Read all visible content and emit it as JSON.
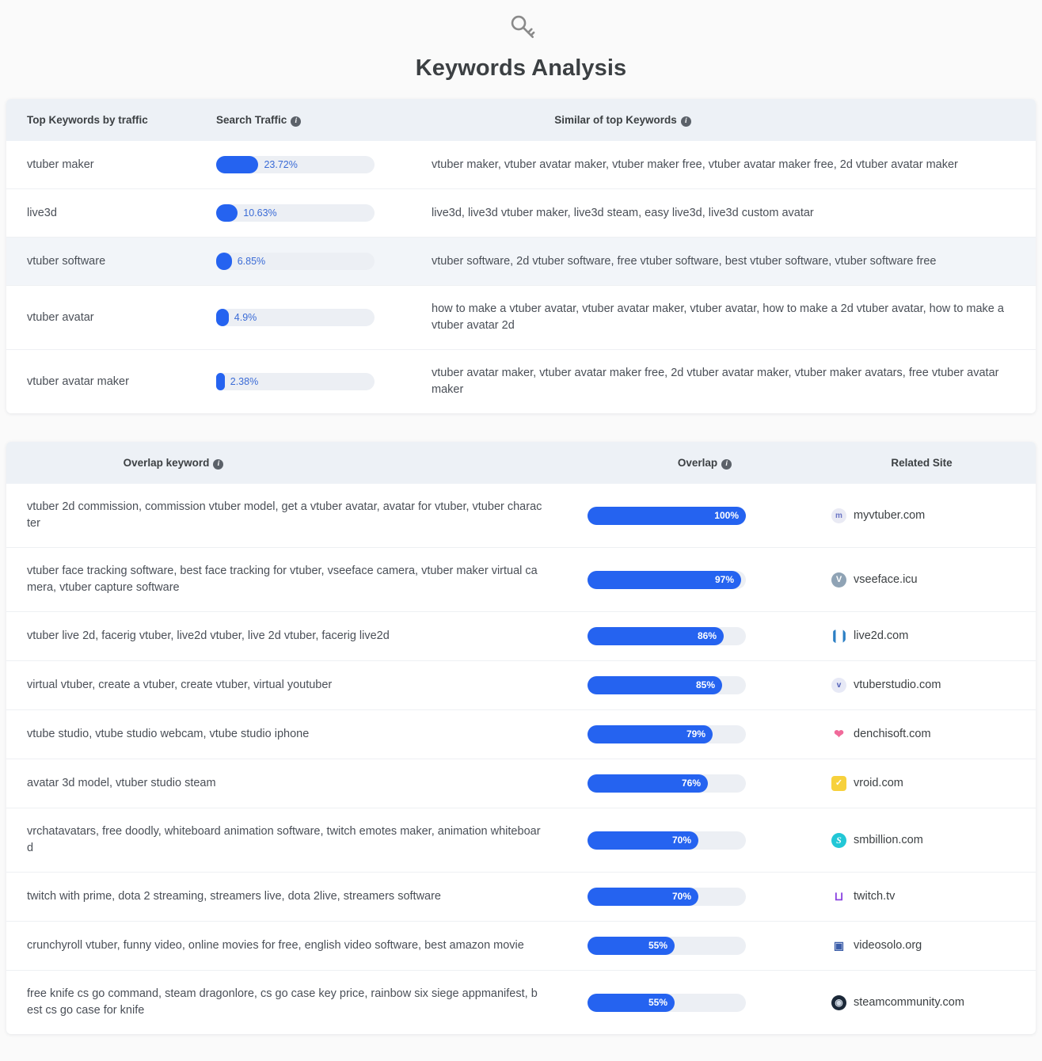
{
  "header": {
    "title": "Keywords Analysis",
    "icon": "key-icon"
  },
  "keywords_table": {
    "columns": {
      "keyword": "Top Keywords by traffic",
      "traffic": "Search Traffic",
      "similar": "Similar of top Keywords"
    },
    "info_icon": "i",
    "rows": [
      {
        "keyword": "vtuber maker",
        "traffic_label": "23.72%",
        "traffic_value": 23.72,
        "similar": "vtuber maker, vtuber avatar maker, vtuber maker free, vtuber avatar maker free, 2d vtuber avatar maker"
      },
      {
        "keyword": "live3d",
        "traffic_label": "10.63%",
        "traffic_value": 10.63,
        "similar": "live3d, live3d vtuber maker, live3d steam, easy live3d, live3d custom avatar"
      },
      {
        "keyword": "vtuber software",
        "traffic_label": "6.85%",
        "traffic_value": 6.85,
        "similar": "vtuber software, 2d vtuber software, free vtuber software, best vtuber software, vtuber software free"
      },
      {
        "keyword": "vtuber avatar",
        "traffic_label": "4.9%",
        "traffic_value": 4.9,
        "similar": "how to make a vtuber avatar, vtuber avatar maker, vtuber avatar, how to make a 2d vtuber avatar, how to make a vtuber avatar 2d"
      },
      {
        "keyword": "vtuber avatar maker",
        "traffic_label": "2.38%",
        "traffic_value": 2.38,
        "similar": "vtuber avatar maker, vtuber avatar maker free, 2d vtuber avatar maker, vtuber maker avatars, free vtuber avatar maker"
      }
    ]
  },
  "overlap_table": {
    "columns": {
      "keyword": "Overlap keyword",
      "overlap": "Overlap",
      "site": "Related Site"
    },
    "info_icon": "i",
    "rows": [
      {
        "keyword": "vtuber 2d commission, commission vtuber model, get a vtuber avatar, avatar for vtuber, vtuber character",
        "overlap_label": "100%",
        "overlap_value": 100,
        "site": "myvtuber.com",
        "icon": "myvtuber-favicon",
        "icon_glyph": "m",
        "icon_class": "ico-myvtuber"
      },
      {
        "keyword": "vtuber face tracking software, best face tracking for vtuber, vseeface camera, vtuber maker virtual camera, vtuber capture software",
        "overlap_label": "97%",
        "overlap_value": 97,
        "site": "vseeface.icu",
        "icon": "vseeface-favicon",
        "icon_glyph": "V",
        "icon_class": "ico-vseeface"
      },
      {
        "keyword": "vtuber live 2d, facerig vtuber, live2d vtuber, live 2d vtuber, facerig live2d",
        "overlap_label": "86%",
        "overlap_value": 86,
        "site": "live2d.com",
        "icon": "live2d-favicon",
        "icon_glyph": "❙❙",
        "icon_class": "ico-live2d"
      },
      {
        "keyword": "virtual vtuber, create a vtuber, create vtuber, virtual youtuber",
        "overlap_label": "85%",
        "overlap_value": 85,
        "site": "vtuberstudio.com",
        "icon": "vtuberstudio-favicon",
        "icon_glyph": "v",
        "icon_class": "ico-vtuberstudio"
      },
      {
        "keyword": "vtube studio, vtube studio webcam, vtube studio iphone",
        "overlap_label": "79%",
        "overlap_value": 79,
        "site": "denchisoft.com",
        "icon": "denchisoft-favicon",
        "icon_glyph": "❤",
        "icon_class": "ico-denchisoft"
      },
      {
        "keyword": "avatar 3d model, vtuber studio steam",
        "overlap_label": "76%",
        "overlap_value": 76,
        "site": "vroid.com",
        "icon": "vroid-favicon",
        "icon_glyph": "✓",
        "icon_class": "ico-vroid"
      },
      {
        "keyword": "vrchatavatars, free doodly, whiteboard animation software, twitch emotes maker, animation whiteboard",
        "overlap_label": "70%",
        "overlap_value": 70,
        "site": "smbillion.com",
        "icon": "smbillion-favicon",
        "icon_glyph": "S",
        "icon_class": "ico-smbillion"
      },
      {
        "keyword": "twitch with prime, dota 2 streaming, streamers live, dota 2live, streamers software",
        "overlap_label": "70%",
        "overlap_value": 70,
        "site": "twitch.tv",
        "icon": "twitch-favicon",
        "icon_glyph": "⊔",
        "icon_class": "ico-twitch"
      },
      {
        "keyword": "crunchyroll vtuber, funny video, online movies for free, english video software, best amazon movie",
        "overlap_label": "55%",
        "overlap_value": 55,
        "site": "videosolo.org",
        "icon": "videosolo-favicon",
        "icon_glyph": "▣",
        "icon_class": "ico-videosolo"
      },
      {
        "keyword": "free knife cs go command, steam dragonlore, cs go case key price, rainbow six siege appmanifest, best cs go case for knife",
        "overlap_label": "55%",
        "overlap_value": 55,
        "site": "steamcommunity.com",
        "icon": "steam-favicon",
        "icon_glyph": "◉",
        "icon_class": "ico-steam"
      }
    ]
  },
  "colors": {
    "accent": "#2563f0",
    "track": "#eceff4",
    "header_bg": "#edf1f6",
    "text": "#3c4043"
  }
}
